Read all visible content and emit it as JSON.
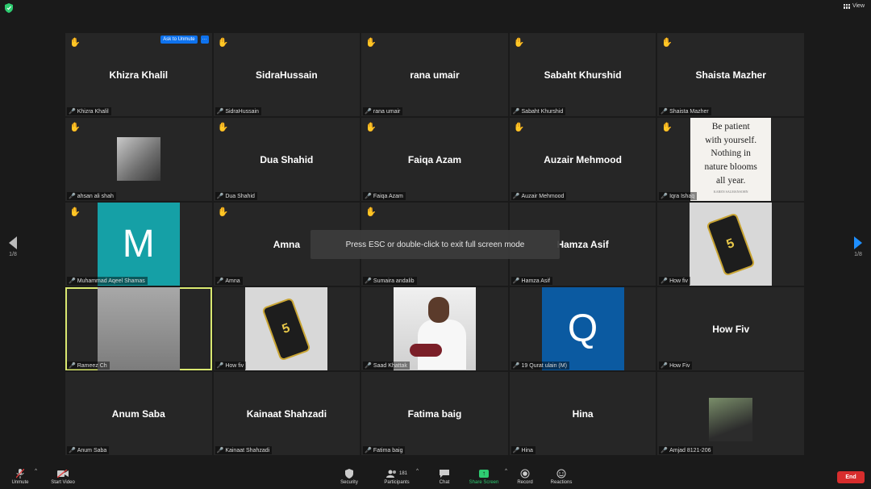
{
  "top": {
    "view_label": "View"
  },
  "participants": [
    {
      "name": "Khizra Khalil",
      "label": "Khizra Khalil",
      "display": "name",
      "hand": true,
      "ask_unmute": "Ask to Unmute",
      "more": "···"
    },
    {
      "name": "SidraHussain",
      "label": "SidraHussain",
      "display": "name",
      "hand": true
    },
    {
      "name": "rana umair",
      "label": "rana umair",
      "display": "name",
      "hand": true
    },
    {
      "name": "Sabaht Khurshid",
      "label": "Sabaht Khurshid",
      "display": "name",
      "hand": true
    },
    {
      "name": "Shaista Mazher",
      "label": "Shaista Mazher",
      "display": "name",
      "hand": true
    },
    {
      "name": "",
      "label": "ahsan ali shah",
      "display": "photo-dog",
      "hand": true
    },
    {
      "name": "Dua Shahid",
      "label": "Dua Shahid",
      "display": "name",
      "hand": true
    },
    {
      "name": "Faiqa Azam",
      "label": "Faiqa Azam",
      "display": "name",
      "hand": true
    },
    {
      "name": "Auzair Mehmood",
      "label": "Auzair Mehmood",
      "display": "name",
      "hand": true
    },
    {
      "name": "",
      "label": "Iqra Ishaq",
      "display": "quote",
      "hand": true,
      "quote": [
        "Be patient",
        "with yourself.",
        "Nothing in",
        "nature blooms",
        "all year."
      ],
      "quote_credit": "KAREN SALMANSOHN"
    },
    {
      "name": "M",
      "label": "Muhammad Aqeel Shamas",
      "display": "avatar-m",
      "hand": true
    },
    {
      "name": "Amna",
      "label": "Amna",
      "display": "name",
      "hand": true
    },
    {
      "name": "",
      "label": "Sumaira andalib",
      "display": "name",
      "hand": true
    },
    {
      "name": "Hamza Asif",
      "label": "Hamza Asif",
      "display": "name",
      "hand": false
    },
    {
      "name": "",
      "label": "How fiv",
      "display": "book",
      "hand": false,
      "book_text": "5"
    },
    {
      "name": "",
      "label": "Rameez Ch",
      "display": "blur",
      "hand": false,
      "active": true
    },
    {
      "name": "",
      "label": "How fiv",
      "display": "book",
      "hand": false,
      "book_text": "5"
    },
    {
      "name": "",
      "label": "Saad Khattak",
      "display": "saad",
      "hand": false
    },
    {
      "name": "Q",
      "label": "19 Qurat ulain (M)",
      "display": "avatar-q",
      "hand": false
    },
    {
      "name": "How Fiv",
      "label": "How Fiv",
      "display": "name",
      "hand": false
    },
    {
      "name": "Anum Saba",
      "label": "Anum Saba",
      "display": "name",
      "hand": false
    },
    {
      "name": "Kainaat Shahzadi",
      "label": "Kainaat Shahzadi",
      "display": "name",
      "hand": false
    },
    {
      "name": "Fatima baig",
      "label": "Fatima baig",
      "display": "name",
      "hand": false
    },
    {
      "name": "Hina",
      "label": "Hina",
      "display": "name",
      "hand": false
    },
    {
      "name": "",
      "label": "Amjad 8121-206",
      "display": "photo-amjad",
      "hand": false
    }
  ],
  "toast": "Press ESC or double-click to exit full screen mode",
  "nav": {
    "left_page": "1/8",
    "right_page": "1/8"
  },
  "toolbar": {
    "unmute": "Unmute",
    "start_video": "Start Video",
    "security": "Security",
    "participants": "Participants",
    "participants_count": "181",
    "chat": "Chat",
    "share_screen": "Share Screen",
    "record": "Record",
    "reactions": "Reactions",
    "end": "End"
  },
  "colors": {
    "accent": "#0e72ed",
    "share": "#2ecc71",
    "end": "#d72d2d",
    "active_border": "#d9e870",
    "muted_mic": "#e23b3b"
  }
}
